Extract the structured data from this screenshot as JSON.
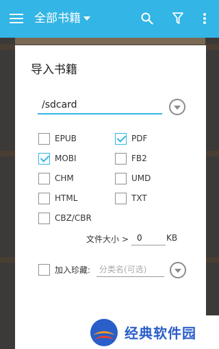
{
  "app_bar": {
    "title": "全部书籍",
    "colors": {
      "background": "#33b5e5"
    },
    "icons": [
      "menu-icon",
      "dropdown-caret-icon",
      "search-icon",
      "filter-icon",
      "more-icon"
    ]
  },
  "dialog": {
    "title": "导入书籍",
    "path_value": "/sdcard",
    "formats": [
      {
        "label": "EPUB",
        "checked": false
      },
      {
        "label": "PDF",
        "checked": true
      },
      {
        "label": "MOBI",
        "checked": true
      },
      {
        "label": "FB2",
        "checked": false
      },
      {
        "label": "CHM",
        "checked": false
      },
      {
        "label": "UMD",
        "checked": false
      },
      {
        "label": "HTML",
        "checked": false
      },
      {
        "label": "TXT",
        "checked": false
      },
      {
        "label": "CBZ/CBR",
        "checked": false
      }
    ],
    "file_size_label": "文件大小 >",
    "file_size_value": "0",
    "file_size_unit": "KB",
    "favorite_label": "加入珍藏:",
    "favorite_checked": false,
    "favorite_placeholder": "分类名(可选)",
    "accent_color": "#33b5e5"
  },
  "watermark": {
    "text": "经典软件园"
  }
}
